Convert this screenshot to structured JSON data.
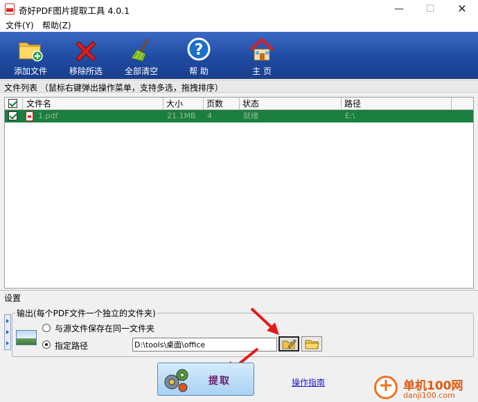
{
  "window": {
    "title": "奇好PDF图片提取工具 4.0.1",
    "min_glyph": "—",
    "max_glyph": "☐",
    "close_glyph": "✕"
  },
  "menu": {
    "items": [
      "文件(Y)",
      "帮助(Z)"
    ]
  },
  "toolbar": {
    "buttons": [
      {
        "label": "添加文件",
        "icon": "add-folder-icon"
      },
      {
        "label": "移除所选",
        "icon": "remove-x-icon"
      },
      {
        "label": "全部清空",
        "icon": "broom-icon"
      },
      {
        "label": "帮 助",
        "icon": "help-icon"
      },
      {
        "label": "主 页",
        "icon": "home-icon"
      }
    ]
  },
  "file_list": {
    "section_title": "文件列表  （鼠标右键弹出操作菜单，支持多选，拖拽排序）",
    "columns": [
      "文件名",
      "大小",
      "页数",
      "状态",
      "路径"
    ],
    "rows": [
      {
        "checked": true,
        "name": "1.pdf",
        "size": "21.1MB",
        "pages": "4",
        "status": "就绪",
        "path": "E:\\"
      }
    ]
  },
  "settings": {
    "title": "设置",
    "output_legend": "输出(每个PDF文件一个独立的文件夹)",
    "option_same_folder": "与源文件保存在同一文件夹",
    "option_custom_path": "指定路径",
    "selected_option": "custom",
    "path_value": "D:\\tools\\桌面\\office"
  },
  "actions": {
    "extract_label": "提取",
    "guide_link": "操作指南"
  },
  "watermark": {
    "title": "单机100网",
    "url": "danji100.com"
  },
  "colors": {
    "toolbar_blue": "#1f4ba3",
    "selected_row_green": "#1a7f3f",
    "extract_button": "#a7d1f3",
    "extract_text": "#6a1a6e",
    "arrow_red": "#e11b1b",
    "watermark_orange": "#e0580d"
  }
}
